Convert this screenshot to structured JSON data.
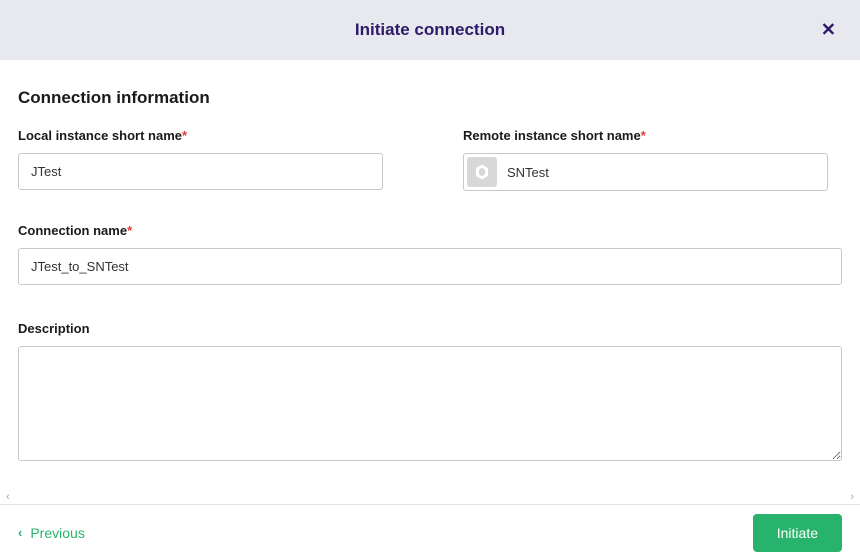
{
  "header": {
    "title": "Initiate connection"
  },
  "section": {
    "title": "Connection information"
  },
  "form": {
    "local_instance": {
      "label": "Local instance short name",
      "value": "JTest"
    },
    "remote_instance": {
      "label": "Remote instance short name",
      "value": "SNTest"
    },
    "connection_name": {
      "label": "Connection name",
      "value": "JTest_to_SNTest"
    },
    "description": {
      "label": "Description",
      "value": ""
    }
  },
  "footer": {
    "previous_label": "Previous",
    "initiate_label": "Initiate"
  }
}
